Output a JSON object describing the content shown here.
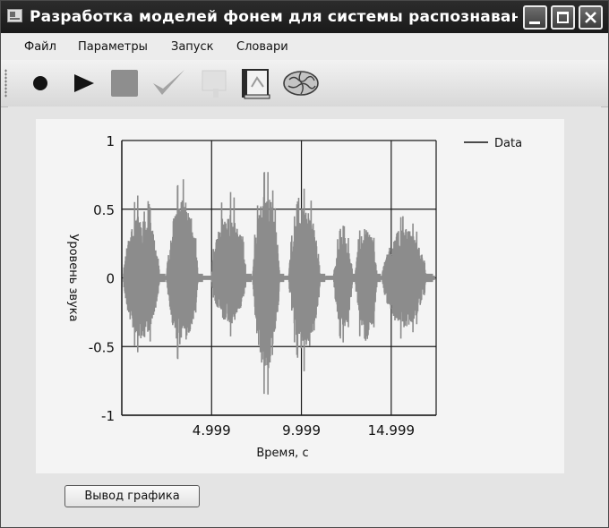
{
  "window": {
    "title": "Разработка моделей фонем для системы распознавания речи"
  },
  "menu": {
    "items": [
      "Файл",
      "Параметры",
      "Запуск",
      "Словари"
    ]
  },
  "toolbar": {
    "icons": [
      "record-icon",
      "play-icon",
      "stop-icon",
      "check-icon",
      "paste-icon",
      "book-icon",
      "brain-icon"
    ]
  },
  "plot_button_label": "Вывод графика",
  "colors": {
    "waveform": "#8c8c8c",
    "grid": "#1a1a1a",
    "panel": "#f4f4f4"
  },
  "chart_data": {
    "type": "line",
    "title": "",
    "xlabel": "Время, с",
    "ylabel": "Уровень звука",
    "xlim": [
      0,
      17.5
    ],
    "ylim": [
      -1,
      1
    ],
    "x_ticks": [
      4.999,
      9.999,
      14.999
    ],
    "x_tick_labels": [
      "4.999",
      "9.999",
      "14.999"
    ],
    "y_ticks": [
      1,
      0.5,
      0,
      -0.5,
      -1
    ],
    "y_tick_labels": [
      "1",
      "0.5",
      "0",
      "-0.5",
      "-1"
    ],
    "grid": true,
    "legend": {
      "position": "top-right",
      "entries": [
        "Data"
      ]
    },
    "series": [
      {
        "name": "Data",
        "bursts": [
          {
            "start": 0.1,
            "end": 2.4,
            "peak_max": 0.62,
            "peak_min": -0.56
          },
          {
            "start": 2.5,
            "end": 4.5,
            "peak_max": 0.72,
            "peak_min": -0.63
          },
          {
            "start": 5.0,
            "end": 7.2,
            "peak_max": 0.63,
            "peak_min": -0.43
          },
          {
            "start": 7.3,
            "end": 9.0,
            "peak_max": 0.78,
            "peak_min": -0.86
          },
          {
            "start": 9.3,
            "end": 11.3,
            "peak_max": 0.65,
            "peak_min": -0.68
          },
          {
            "start": 11.8,
            "end": 13.0,
            "peak_max": 0.38,
            "peak_min": -0.47
          },
          {
            "start": 13.0,
            "end": 14.4,
            "peak_max": 0.47,
            "peak_min": -0.58
          },
          {
            "start": 14.5,
            "end": 17.3,
            "peak_max": 0.45,
            "peak_min": -0.45
          }
        ]
      }
    ]
  }
}
